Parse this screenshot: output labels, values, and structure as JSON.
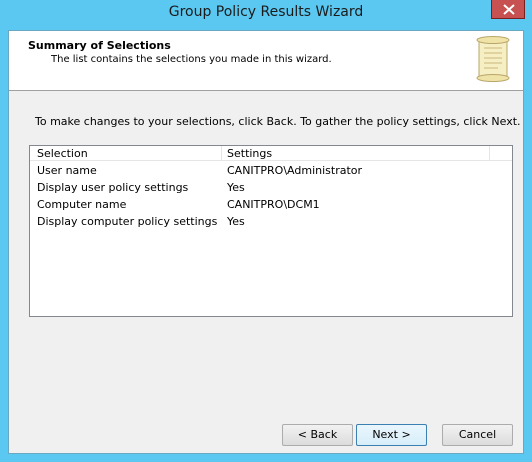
{
  "window": {
    "title": "Group Policy Results Wizard",
    "accent": "#5ac8f0"
  },
  "header": {
    "title": "Summary of Selections",
    "subtitle": "The list contains the selections you made in this wizard."
  },
  "instruction": "To make changes to your selections, click Back. To gather the policy settings, click Next.",
  "list": {
    "columns": [
      "Selection",
      "Settings"
    ],
    "rows": [
      {
        "selection": "User name",
        "setting": "CANITPRO\\Administrator"
      },
      {
        "selection": "Display user policy settings",
        "setting": "Yes"
      },
      {
        "selection": "Computer name",
        "setting": "CANITPRO\\DCM1"
      },
      {
        "selection": "Display computer policy settings",
        "setting": "Yes"
      }
    ]
  },
  "buttons": {
    "back": "< Back",
    "next": "Next >",
    "cancel": "Cancel"
  },
  "icons": {
    "close": "close-icon",
    "wizard": "scroll-icon"
  }
}
